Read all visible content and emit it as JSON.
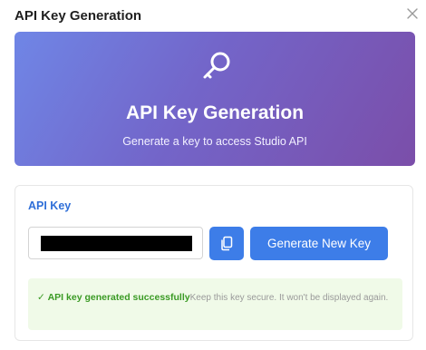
{
  "dialog": {
    "title": "API Key Generation",
    "close_icon": "close-icon"
  },
  "hero": {
    "icon": "key-icon",
    "title": "API Key Generation",
    "subtitle": "Generate a key to access Studio API",
    "gradient_start": "#6f86e6",
    "gradient_end": "#7b4ea9"
  },
  "key_section": {
    "label": "API Key",
    "input_value": "",
    "copy_icon": "copy-icon",
    "generate_button_label": "Generate New Key",
    "accent_color": "#3d7de8"
  },
  "alert": {
    "check_mark": "✓",
    "success_text": "API key generated successfully",
    "warning_text": "Keep this key secure. It won't be displayed again.",
    "background": "#f0fae8",
    "text_color": "#3a9a24"
  }
}
